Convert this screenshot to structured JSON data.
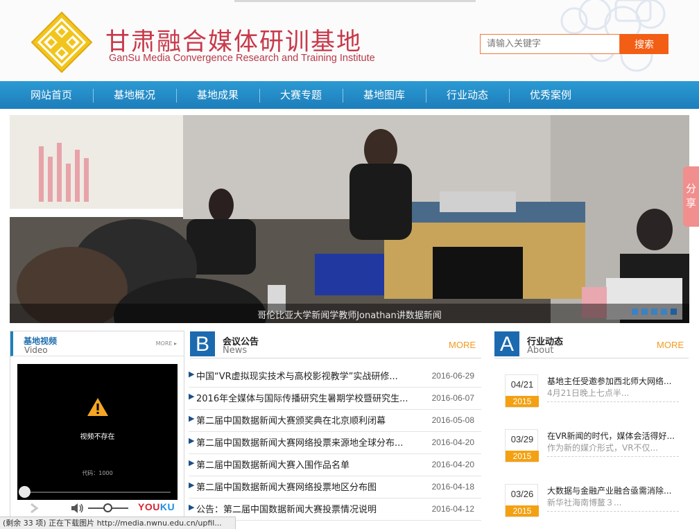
{
  "header": {
    "title_cn": "甘肃融合媒体研训基地",
    "title_en": "GanSu Media Convergence Research and Training Institute",
    "search_placeholder": "请输入关键字",
    "search_button": "搜索"
  },
  "nav": {
    "items": [
      "网站首页",
      "基地概况",
      "基地成果",
      "大赛专题",
      "基地图库",
      "行业动态",
      "优秀案例"
    ]
  },
  "banner": {
    "caption": "哥伦比亚大学新闻学教师Jonathan讲数据新闻",
    "slide_count": 5,
    "active_slide": 5
  },
  "share": {
    "label": "分享"
  },
  "video": {
    "title_cn": "基地视频",
    "title_en": "Video",
    "more": "MORE",
    "message": "视频不存在",
    "code": "代码：1000",
    "brand_a": "YOU",
    "brand_b": "KU"
  },
  "news": {
    "badge": "B",
    "title_cn": "会议公告",
    "title_en": "News",
    "more": "MORE",
    "items": [
      {
        "title": "中国“VR虚拟现实技术与高校影视教学”实战研修...",
        "date": "2016-06-29"
      },
      {
        "title": "2016年全媒体与国际传播研究生暑期学校暨研究生...",
        "date": "2016-06-07"
      },
      {
        "title": "第二届中国数据新闻大赛颁奖典在北京顺利闭幕",
        "date": "2016-05-08"
      },
      {
        "title": "第二届中国数据新闻大赛网络投票来源地全球分布...",
        "date": "2016-04-20"
      },
      {
        "title": "第二届中国数据新闻大赛入围作品名单",
        "date": "2016-04-20"
      },
      {
        "title": "第二届中国数据新闻大赛网络投票地区分布图",
        "date": "2016-04-18"
      },
      {
        "title": "公告：第二届中国数据新闻大赛投票情况说明",
        "date": "2016-04-12"
      }
    ]
  },
  "dynamics": {
    "badge": "A",
    "title_cn": "行业动态",
    "title_en": "About",
    "more": "MORE",
    "items": [
      {
        "md": "04/21",
        "year": "2015",
        "title": "基地主任受邀参加西北师大网络...",
        "sub": "4月21日晚上七点半..."
      },
      {
        "md": "03/29",
        "year": "2015",
        "title": "在VR新闻的时代，媒体会活得好...",
        "sub": "作为新的媒介形式，VR不仅..."
      },
      {
        "md": "03/26",
        "year": "2015",
        "title": "大数据与金融产业融合亟需消除...",
        "sub": "新华社海南博鳌３..."
      }
    ]
  },
  "status": {
    "text": "(剩余 33 项) 正在下载图片 http://media.nwnu.edu.cn/upfil..."
  },
  "colors": {
    "accent": "#1b6ab0",
    "nav": "#2c9ad3",
    "orange": "#f25e14",
    "brand_red": "#c8394a",
    "date_year": "#f3a112"
  }
}
